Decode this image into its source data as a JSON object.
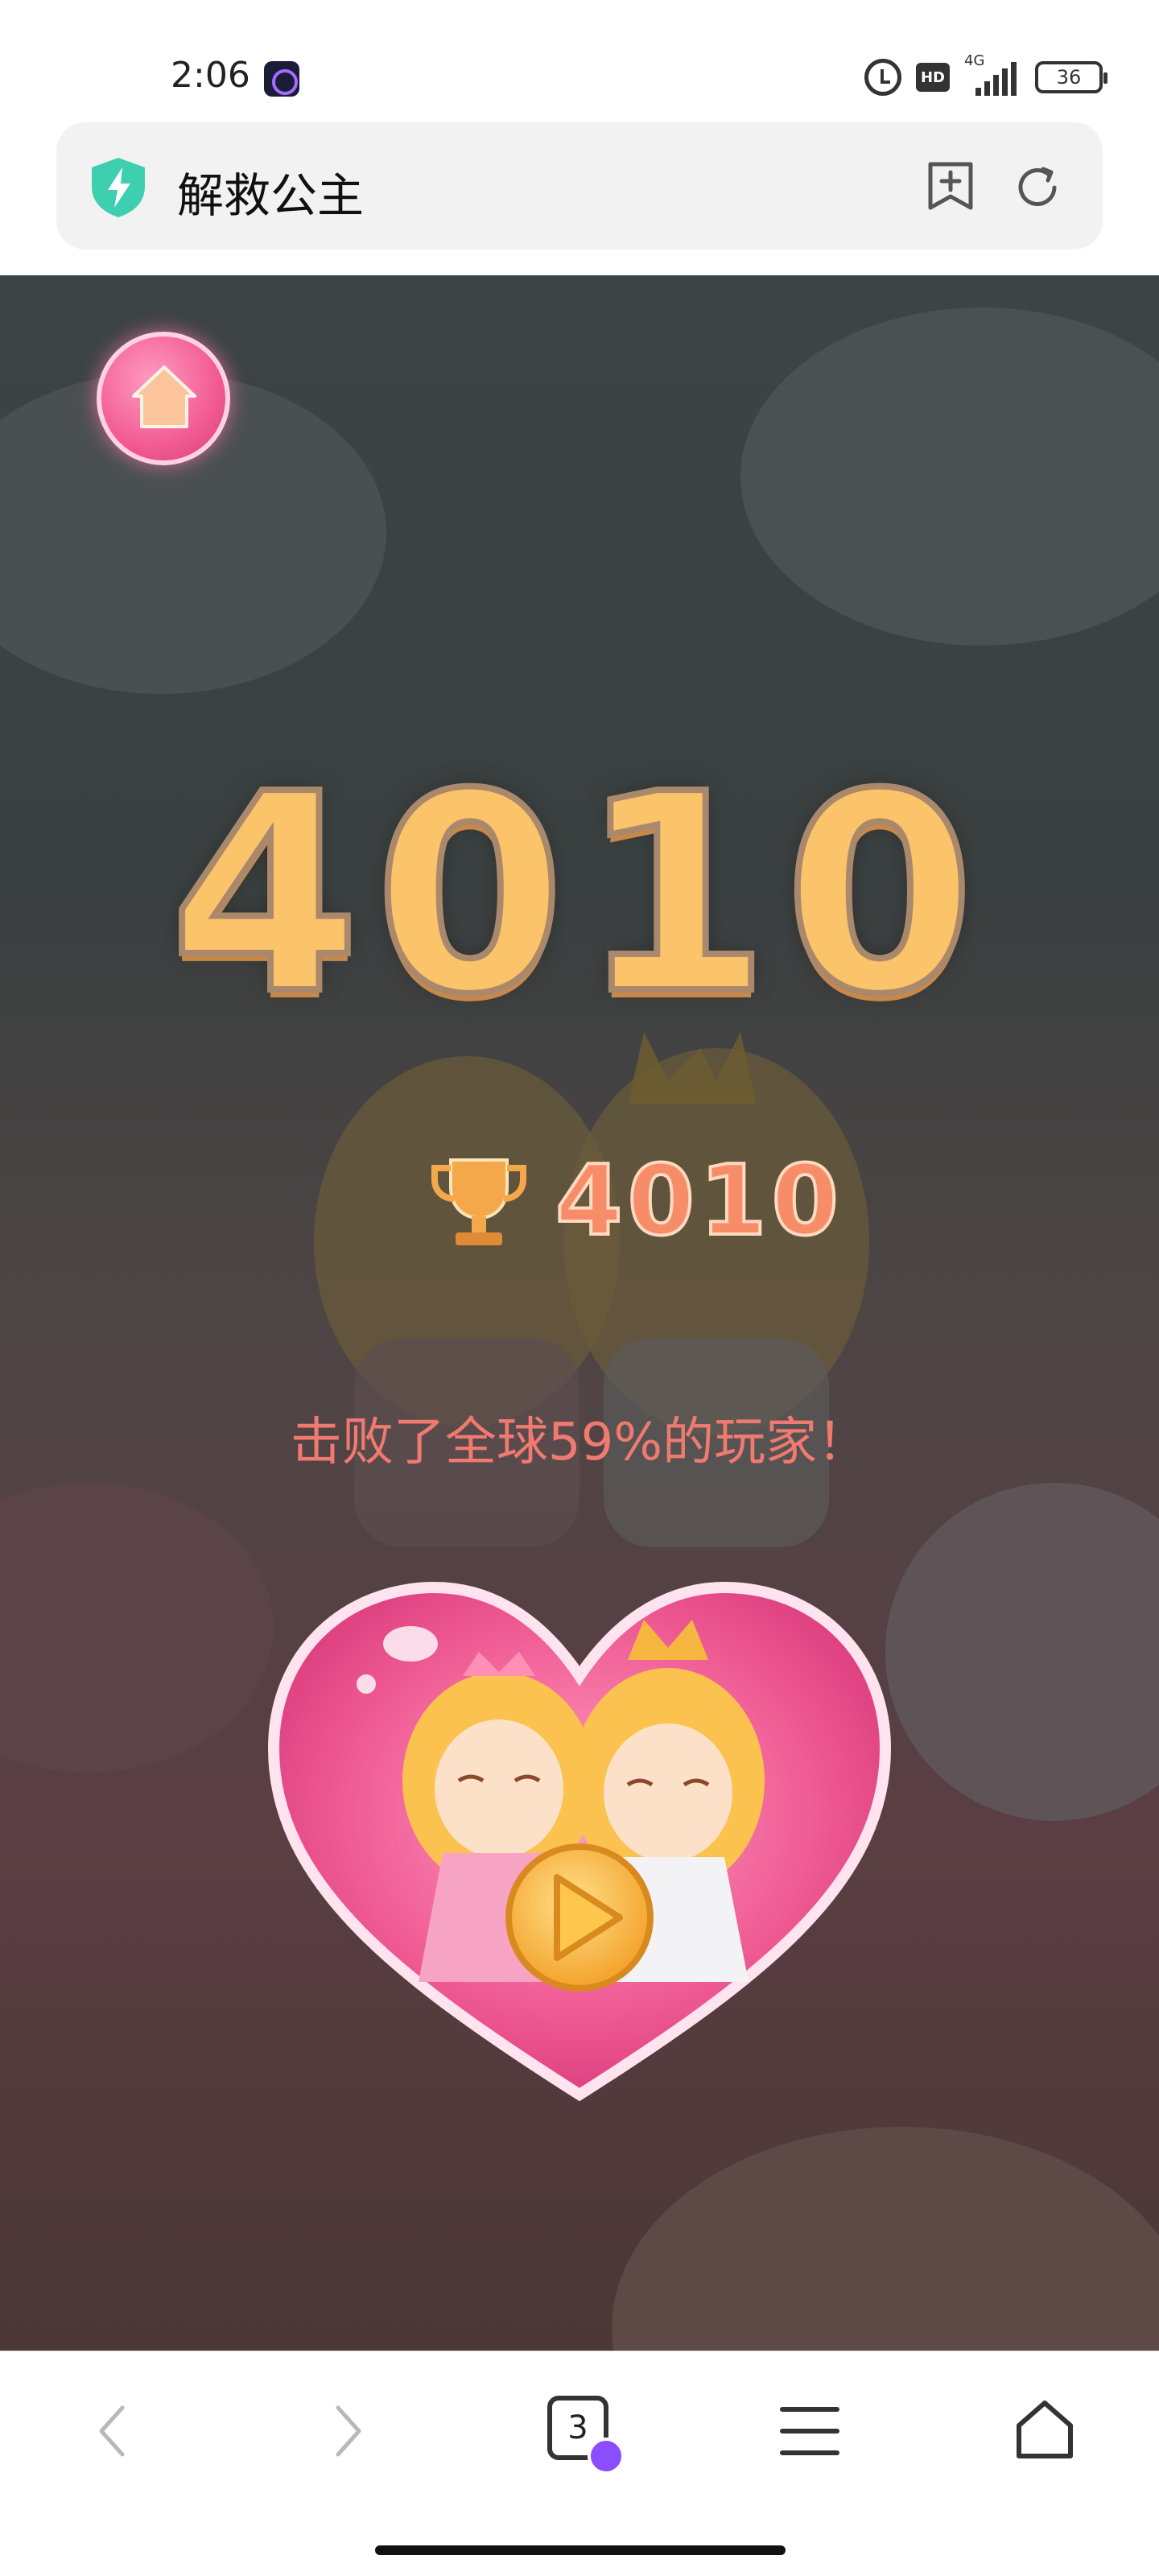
{
  "status_bar": {
    "time": "2:06",
    "hd_label": "HD",
    "network": "4G",
    "battery": "36"
  },
  "address_bar": {
    "title": "解救公主"
  },
  "game": {
    "score": "4010",
    "best_score": "4010",
    "beat_text": "击败了全球59%的玩家！"
  },
  "bottom_nav": {
    "tab_count": "3"
  },
  "colors": {
    "score": "#fbc36a",
    "best_score": "#f78c68",
    "beat_text": "#f07a70",
    "accent_pink": "#f25c92"
  }
}
